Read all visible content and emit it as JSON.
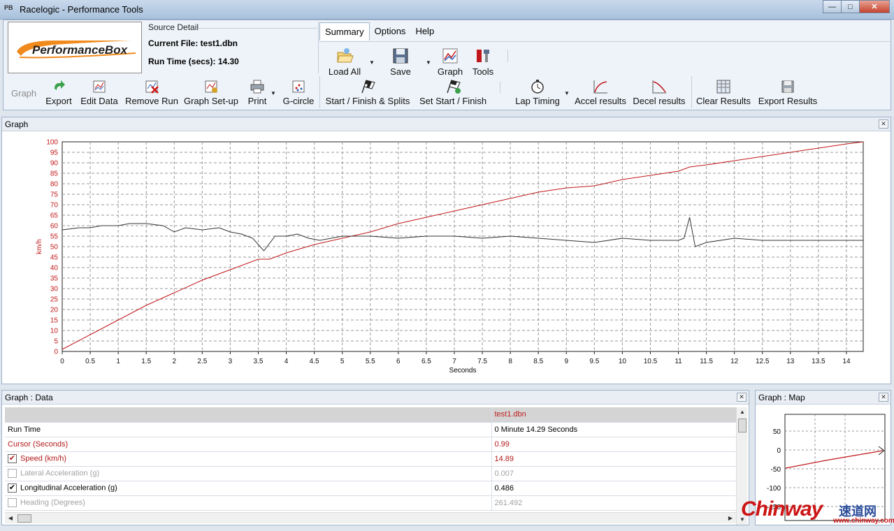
{
  "window": {
    "title": "Racelogic - Performance Tools",
    "app_icon": "PB"
  },
  "logo": {
    "text": "PerformanceBox"
  },
  "source": {
    "header": "Source Detail",
    "current_file_label": "Current File: ",
    "current_file": "test1.dbn",
    "run_time_label": "Run Time (secs): ",
    "run_time": "14.30"
  },
  "menu": {
    "tabs": [
      "Summary",
      "Options",
      "Help"
    ]
  },
  "toolbar_top": {
    "load_all": "Load All",
    "save": "Save",
    "graph": "Graph",
    "tools": "Tools"
  },
  "toolbar": {
    "group_label": "Graph",
    "export": "Export",
    "edit_data": "Edit Data",
    "remove_run": "Remove Run",
    "graph_setup": "Graph Set-up",
    "print": "Print",
    "g_circle": "G-circle",
    "start_finish_splits": "Start / Finish & Splits",
    "set_start_finish": "Set Start / Finish",
    "lap_timing": "Lap Timing",
    "accel_results": "Accel results",
    "decel_results": "Decel results",
    "clear_results": "Clear Results",
    "export_results": "Export Results"
  },
  "graph_panel": {
    "title": "Graph"
  },
  "chart_data": {
    "type": "line",
    "xlabel": "Seconds",
    "ylabel": "km/h",
    "xlim": [
      0,
      14.3
    ],
    "ylim": [
      0,
      100
    ],
    "x_ticks": [
      "0",
      "0.5",
      "1",
      "1.5",
      "2",
      "2.5",
      "3",
      "3.5",
      "4",
      "4.5",
      "5",
      "5.5",
      "6",
      "6.5",
      "7",
      "7.5",
      "8",
      "8.5",
      "9",
      "9.5",
      "10",
      "10.5",
      "11",
      "11.5",
      "12",
      "12.5",
      "13",
      "13.5",
      "14"
    ],
    "y_ticks": [
      "0",
      "5",
      "10",
      "15",
      "20",
      "25",
      "30",
      "35",
      "40",
      "45",
      "50",
      "55",
      "60",
      "65",
      "70",
      "75",
      "80",
      "85",
      "90",
      "95",
      "100"
    ],
    "grid": true,
    "series": [
      {
        "color": "#c0181a",
        "x": [
          0,
          0.5,
          1,
          1.5,
          2,
          2.5,
          3,
          3.3,
          3.5,
          3.7,
          4,
          4.5,
          5,
          5.5,
          6,
          6.5,
          7,
          7.5,
          8,
          8.5,
          9,
          9.5,
          10,
          10.5,
          11,
          11.2,
          11.5,
          12,
          12.5,
          13,
          13.5,
          14,
          14.3
        ],
        "y": [
          1,
          8,
          15,
          22,
          28,
          34,
          39,
          42,
          44,
          44,
          47,
          51,
          54,
          57,
          61,
          64,
          67,
          70,
          73,
          76,
          78,
          79,
          82,
          84,
          86,
          88,
          89,
          91,
          93,
          95,
          97,
          99,
          100
        ]
      },
      {
        "color": "#333333",
        "x": [
          0,
          0.3,
          0.5,
          0.7,
          1,
          1.2,
          1.5,
          1.8,
          2,
          2.2,
          2.5,
          2.8,
          3,
          3.2,
          3.4,
          3.6,
          3.8,
          4,
          4.2,
          4.4,
          4.6,
          4.8,
          5,
          5.5,
          6,
          6.5,
          7,
          7.5,
          8,
          8.5,
          9,
          9.5,
          10,
          10.5,
          11,
          11.1,
          11.2,
          11.3,
          11.5,
          12,
          12.5,
          13,
          13.5,
          14,
          14.3
        ],
        "y": [
          58,
          59,
          59,
          60,
          60,
          61,
          61,
          60,
          57,
          59,
          58,
          59,
          57,
          56,
          54,
          48,
          55,
          55,
          56,
          54,
          53,
          54,
          55,
          55,
          54,
          55,
          55,
          54,
          55,
          54,
          53,
          52,
          54,
          53,
          53,
          54,
          64,
          50,
          52,
          54,
          53,
          53,
          53,
          53,
          53
        ]
      }
    ]
  },
  "data_panel": {
    "title": "Graph : Data",
    "column_header": "test1.dbn",
    "rows": [
      {
        "name": "Run Time",
        "value": "0 Minute 14.29 Seconds"
      },
      {
        "name": "Cursor (Seconds)",
        "value": "0.99"
      },
      {
        "name": "Speed (km/h)",
        "value": "14.89",
        "checked": true
      },
      {
        "name": "Lateral Acceleration (g)",
        "value": "0.007",
        "checked": false
      },
      {
        "name": "Longitudinal Acceleration (g)",
        "value": "0.486",
        "checked": true
      },
      {
        "name": "Heading (Degrees)",
        "value": "261.492",
        "checked": false
      }
    ]
  },
  "map_panel": {
    "title": "Graph : Map",
    "y_ticks": [
      "50",
      "0",
      "-50",
      "-100",
      "-150"
    ]
  },
  "watermark": {
    "text": "Chinway",
    "cn": "速道网",
    "domain": "www.chinway.com.cn"
  }
}
